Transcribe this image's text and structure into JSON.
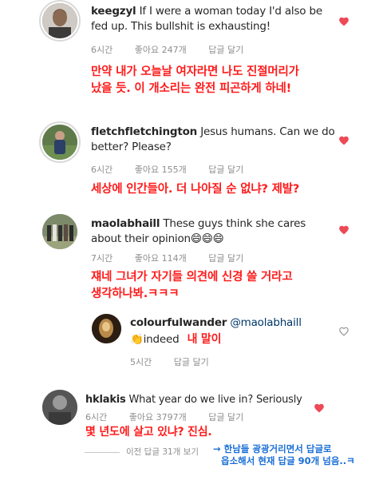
{
  "comments": [
    {
      "username": "keegzyl",
      "text": "If I were a woman today I'd also be fed up. This bullshit is exhausting!",
      "time": "6시간",
      "likes": "좋아요 247개",
      "reply": "답글 달기",
      "translation_line1": "만약 내가 오늘날 여자라면 나도 진절머리가",
      "translation_line2": "났을 듯. 이 개소리는 완전 피곤하게 하네!"
    },
    {
      "username": "fletchfletchington",
      "text": "Jesus humans. Can we do better? Please?",
      "time": "6시간",
      "likes": "좋아요 155개",
      "reply": "답글 달기",
      "translation_line1": "세상에 인간들아. 더 나아질 순 없냐? 제발?"
    },
    {
      "username": "maolabhaill",
      "text": "These guys think she cares about their opinion",
      "emoji": "😄😄😄",
      "time": "7시간",
      "likes": "좋아요 114개",
      "reply": "답글 달기",
      "translation_line1": "쟤네 그녀가 자기들 의견에 신경 쓸 거라고",
      "translation_line2": "생각하나봐.ㅋㅋㅋ"
    },
    {
      "username": "colourfulwander",
      "mention": "@maolabhaill",
      "emoji": "👏",
      "text": "indeed",
      "translation": "내 말이",
      "time": "5시간",
      "reply": "답글 달기"
    },
    {
      "username": "hklakis",
      "text": "What year do we live in? Seriously",
      "time": "6시간",
      "likes": "좋아요 3797개",
      "reply": "답글 달기",
      "translation_line1": "몇 년도에 살고 있냐? 진심."
    }
  ],
  "view_previous": "이전 답글 31개 보기",
  "note_line1": "→ 한남들 광광거리면서 답글로",
  "note_line2": "읍소해서 현재 답글 90개 넘음..ㅋ",
  "colors": {
    "heart_red": "#ed4956",
    "translation_red": "#ff1a1a",
    "note_blue": "#1a6fd6"
  }
}
